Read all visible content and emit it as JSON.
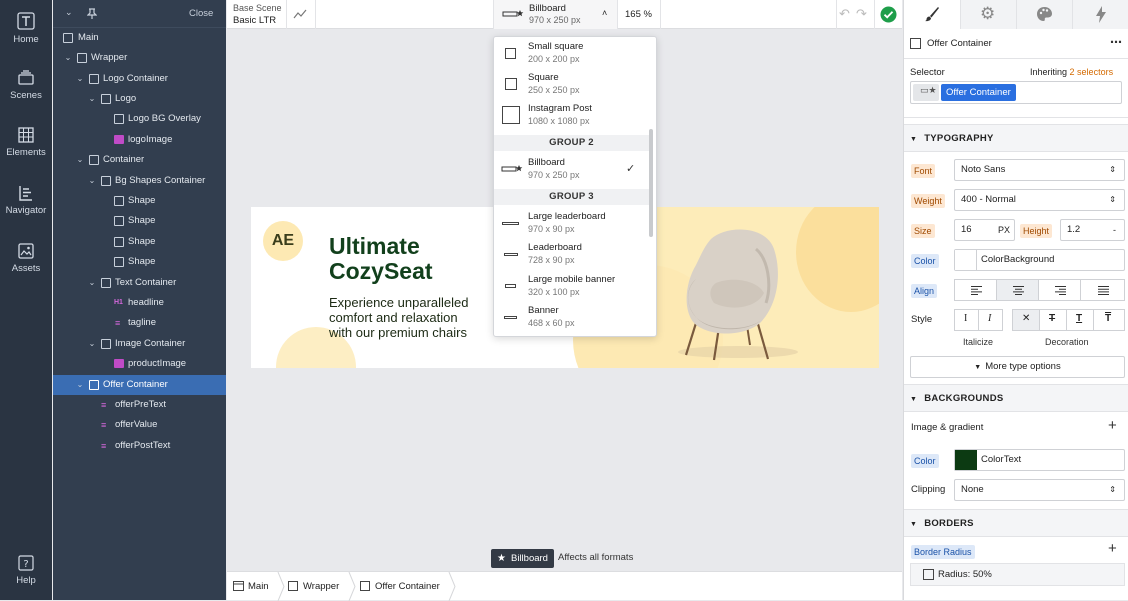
{
  "nav": {
    "items": [
      {
        "label": "Home",
        "icon": "text-t-icon"
      },
      {
        "label": "Scenes",
        "icon": "scenes-icon"
      },
      {
        "label": "Elements",
        "icon": "elements-icon"
      },
      {
        "label": "Navigator",
        "icon": "navigator-icon"
      },
      {
        "label": "Assets",
        "icon": "assets-icon"
      }
    ],
    "help": "Help"
  },
  "layers": {
    "close_label": "Close",
    "tree": [
      {
        "label": "Main"
      },
      {
        "label": "Wrapper"
      },
      {
        "label": "Logo Container"
      },
      {
        "label": "Logo"
      },
      {
        "label": "Logo BG Overlay"
      },
      {
        "label": "logoImage"
      },
      {
        "label": "Container"
      },
      {
        "label": "Bg Shapes Container"
      },
      {
        "label": "Shape"
      },
      {
        "label": "Shape"
      },
      {
        "label": "Shape"
      },
      {
        "label": "Shape"
      },
      {
        "label": "Text Container"
      },
      {
        "label": "headline"
      },
      {
        "label": "tagline"
      },
      {
        "label": "Image Container"
      },
      {
        "label": "productImage"
      },
      {
        "label": "Offer Container"
      },
      {
        "label": "offerPreText"
      },
      {
        "label": "offerValue"
      },
      {
        "label": "offerPostText"
      }
    ]
  },
  "topbar": {
    "scene_label": "Base Scene",
    "scene_value": "Basic LTR",
    "format_name": "Billboard",
    "format_size": "970 x 250 px",
    "zoom": "165 %"
  },
  "dropdown": {
    "items": [
      {
        "name": "Small square",
        "size": "200 x 200 px"
      },
      {
        "name": "Square",
        "size": "250 x 250 px"
      },
      {
        "name": "Instagram Post",
        "size": "1080 x 1080 px"
      },
      {
        "name": "Billboard",
        "size": "970 x 250 px"
      },
      {
        "name": "Large leaderboard",
        "size": "970 x 90 px"
      },
      {
        "name": "Leaderboard",
        "size": "728 x 90 px"
      },
      {
        "name": "Large mobile banner",
        "size": "320 x 100 px"
      },
      {
        "name": "Banner",
        "size": "468 x 60 px"
      }
    ],
    "group2": "GROUP 2",
    "group3": "GROUP 3"
  },
  "banner": {
    "logo": "AE",
    "headline_1": "Ultimate",
    "headline_2": "CozySeat",
    "tagline_1": "Experience unparalleled",
    "tagline_2": "comfort and relaxation",
    "tagline_3": "with our premium chairs",
    "colors": {
      "headline": "#12401c",
      "shape": "#fde9b3"
    }
  },
  "canvas_footer": {
    "badge": "Billboard",
    "note": "Affects all formats"
  },
  "breadcrumb": [
    "Main",
    "Wrapper",
    "Offer Container"
  ],
  "right": {
    "element": "Offer Container",
    "selector_label": "Selector",
    "inheriting": "Inheriting",
    "inheriting_count": "2 selectors",
    "selector_chip": "Offer Container",
    "typography": "TYPOGRAPHY",
    "font_label": "Font",
    "font_value": "Noto Sans",
    "weight_label": "Weight",
    "weight_value": "400 - Normal",
    "size_label": "Size",
    "size_value": "16",
    "size_unit": "PX",
    "height_label": "Height",
    "height_value": "1.2",
    "height_suffix": "-",
    "color_label": "Color",
    "color_value": "ColorBackground",
    "align_label": "Align",
    "style_label": "Style",
    "italicize": "Italicize",
    "decoration": "Decoration",
    "more_type": "More type options",
    "backgrounds": "BACKGROUNDS",
    "image_gradient": "Image & gradient",
    "bg_color_label": "Color",
    "bg_color_value": "ColorText",
    "bg_color_swatch": "#0c3a12",
    "clipping_label": "Clipping",
    "clipping_value": "None",
    "borders": "BORDERS",
    "border_radius_label": "Border Radius",
    "radius_value": "Radius: 50%"
  },
  "colors": {
    "accent_blue": "#3a6db3",
    "chip_blue": "#2a6fe0",
    "success_green": "#1e9e4a"
  }
}
